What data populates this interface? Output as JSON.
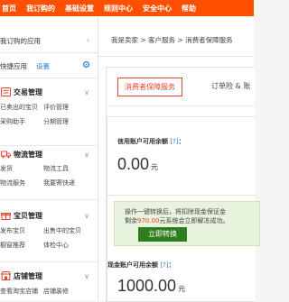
{
  "topbar": {
    "items": [
      "首页",
      "我订购的",
      "基础设置",
      "规则中心",
      "安全中心",
      "帮助"
    ]
  },
  "sidebar": {
    "my_apps": "我订购的应用",
    "quick_apps": "快捷应用",
    "settings_link": "设置",
    "sections": [
      {
        "title": "交易管理",
        "icon": "trade-icon",
        "links": [
          "已卖出的宝贝",
          "评价管理",
          "采购助手",
          "分期管理"
        ]
      },
      {
        "title": "物流管理",
        "icon": "truck-icon",
        "links": [
          "发货",
          "物流工具",
          "物流服务",
          "我要寄快递"
        ]
      },
      {
        "title": "宝贝管理",
        "icon": "gift-icon",
        "links": [
          "发布宝贝",
          "出售中的宝贝",
          "橱窗推荐",
          "体检中心"
        ]
      },
      {
        "title": "店铺管理",
        "icon": "store-icon",
        "links": [
          "查看淘宝店铺",
          "店铺装修"
        ]
      }
    ]
  },
  "breadcrumb": "我是卖家 > 客户服务 > 消费者保障服务",
  "tabs": {
    "active": "消费者保障服务",
    "second": "订单险 & 账"
  },
  "credit": {
    "label": "信用账户可用余额",
    "help": "[?]",
    "colon": "：",
    "amount": "0.00",
    "unit": "元"
  },
  "notice": {
    "line1": "操作一键转换后，将扣除现金保证金",
    "line2_prefix": "剩余",
    "line2_amount": "970.00",
    "line2_suffix": "元系统会立即解冻成功。",
    "button": "立即转换"
  },
  "cash": {
    "label": "现金账户可用余额",
    "help": "[?]",
    "colon": "：",
    "amount": "1000.00",
    "unit": "元"
  },
  "colors": {
    "brand": "#ff5000",
    "accent": "#e4432d",
    "button": "#2f7d20",
    "notice_bg": "#e8f3dd",
    "link": "#2a7bd1"
  }
}
